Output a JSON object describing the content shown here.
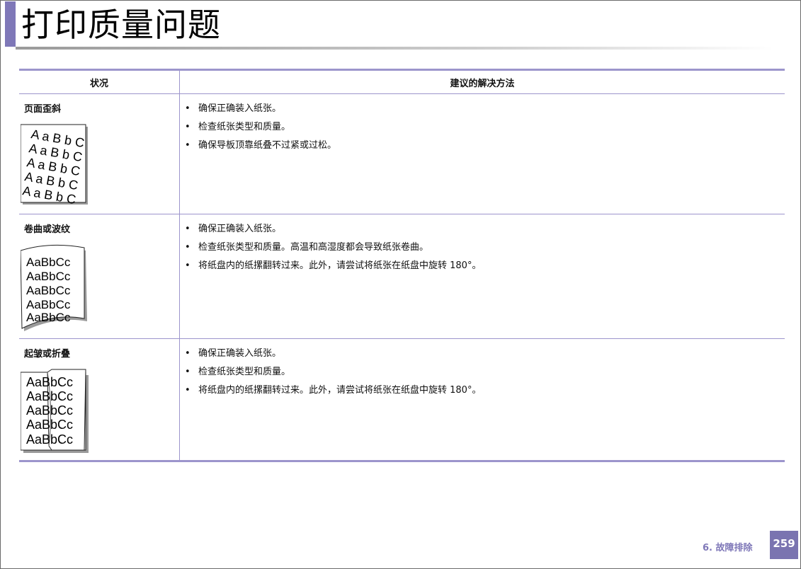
{
  "page": {
    "title": "打印质量问题",
    "footer": {
      "section": "6.  故障排除",
      "page_number": "259"
    }
  },
  "table": {
    "headers": [
      "状况",
      "建议的解决方法"
    ],
    "rows": [
      {
        "situation": "页面歪斜",
        "illustration": "skewed-page-illustration",
        "solutions": [
          "确保正确装入纸张。",
          "检查纸张类型和质量。",
          "确保导板顶靠纸叠不过紧或过松。"
        ]
      },
      {
        "situation": "卷曲或波纹",
        "illustration": "curled-page-illustration",
        "solutions": [
          "确保正确装入纸张。",
          "检查纸张类型和质量。高温和高湿度都会导致纸张卷曲。",
          "将纸盘内的纸摞翻转过来。此外，请尝试将纸张在纸盘中旋转 180°。"
        ]
      },
      {
        "situation": "起皱或折叠",
        "illustration": "wrinkled-page-illustration",
        "solutions": [
          "确保正确装入纸张。",
          "检查纸张类型和质量。",
          "将纸盘内的纸摞翻转过来。此外，请尝试将纸张在纸盘中旋转 180°。"
        ]
      }
    ]
  },
  "illustrations": {
    "sample_text": "AaBbCc",
    "skewed_lines": [
      "A a B b C",
      "A a B b C",
      "A a B b C",
      "A a B b C",
      "A a B b C"
    ],
    "curled_lines": [
      "AaBbCc",
      "AaBbCc",
      "AaBbCc",
      "AaBbCc",
      "AaBbCc"
    ],
    "wrinkled_lines": [
      "AaBbCc",
      "AaBbCc",
      "AaBbCc",
      "AaBbCc",
      "AaBbCc"
    ]
  },
  "colors": {
    "accent": "#7f78b8",
    "rule": "#9c95cc"
  }
}
